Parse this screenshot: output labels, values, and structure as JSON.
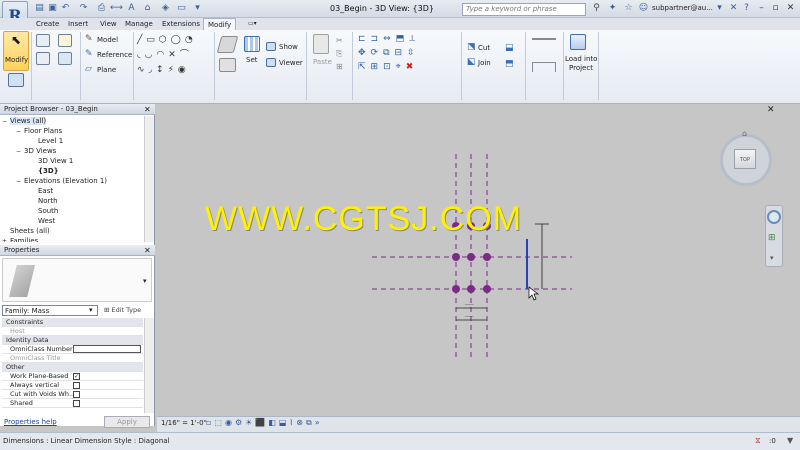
{
  "app": {
    "logo_letter": "R",
    "doc_title": "03_Begin - 3D View: {3D}",
    "search_placeholder": "Type a keyword or phrase",
    "user": "subpartner@au..."
  },
  "tabs": [
    "Create",
    "Insert",
    "View",
    "Manage",
    "Extensions",
    "Modify"
  ],
  "ribbon": {
    "modify_label": "Modify",
    "model_label": "Model",
    "reference_label": "Reference",
    "plane_label": "Plane",
    "set_label": "Set",
    "show_label": "Show",
    "viewer_label": "Viewer",
    "paste_label": "Paste",
    "cut_label": "Cut",
    "join_label": "Join",
    "load_into_label": "Load into",
    "project_label": "Project"
  },
  "project_browser": {
    "title": "Project Browser - 03_Begin",
    "items": [
      {
        "label": "Views (all)",
        "level": 0,
        "toggle": "−"
      },
      {
        "label": "Floor Plans",
        "level": 1,
        "toggle": "−"
      },
      {
        "label": "Level 1",
        "level": 2,
        "toggle": ""
      },
      {
        "label": "3D Views",
        "level": 1,
        "toggle": "−"
      },
      {
        "label": "3D View 1",
        "level": 2,
        "toggle": ""
      },
      {
        "label": "{3D}",
        "level": 2,
        "toggle": "",
        "bold": true
      },
      {
        "label": "Elevations (Elevation 1)",
        "level": 1,
        "toggle": "−"
      },
      {
        "label": "East",
        "level": 2,
        "toggle": ""
      },
      {
        "label": "North",
        "level": 2,
        "toggle": ""
      },
      {
        "label": "South",
        "level": 2,
        "toggle": ""
      },
      {
        "label": "West",
        "level": 2,
        "toggle": ""
      },
      {
        "label": "Sheets (all)",
        "level": 0,
        "toggle": ""
      },
      {
        "label": "Families",
        "level": 0,
        "toggle": "+"
      }
    ]
  },
  "properties": {
    "title": "Properties",
    "family": "Family: Mass",
    "edit_type": "Edit Type",
    "sections": [
      {
        "header": "Constraints",
        "rows": [
          {
            "label": "Host",
            "value": "",
            "kind": "grey"
          }
        ]
      },
      {
        "header": "Identity Data",
        "rows": [
          {
            "label": "OmniClass Number",
            "value": "",
            "kind": "input"
          },
          {
            "label": "OmniClass Title",
            "value": "",
            "kind": "grey"
          }
        ]
      },
      {
        "header": "Other",
        "rows": [
          {
            "label": "Work Plane-Based",
            "value": "✓",
            "kind": "check"
          },
          {
            "label": "Always vertical",
            "value": "",
            "kind": "check"
          },
          {
            "label": "Cut with Voids Wh...",
            "value": "",
            "kind": "check"
          },
          {
            "label": "Shared",
            "value": "",
            "kind": "check"
          }
        ]
      }
    ],
    "help_link": "Properties help",
    "apply": "Apply"
  },
  "viewcube": {
    "face": "TOP"
  },
  "watermark": "WWW.CGTSJ.COM",
  "view_scale": "1/16\" = 1'-0\"",
  "status_text": "Dimensions : Linear Dimension Style : Diagonal",
  "status_count": ":0",
  "colors": {
    "accent_purple": "#7b2a85",
    "watermark_yellow": "#fff200",
    "blue_line": "#2b3fbf"
  }
}
